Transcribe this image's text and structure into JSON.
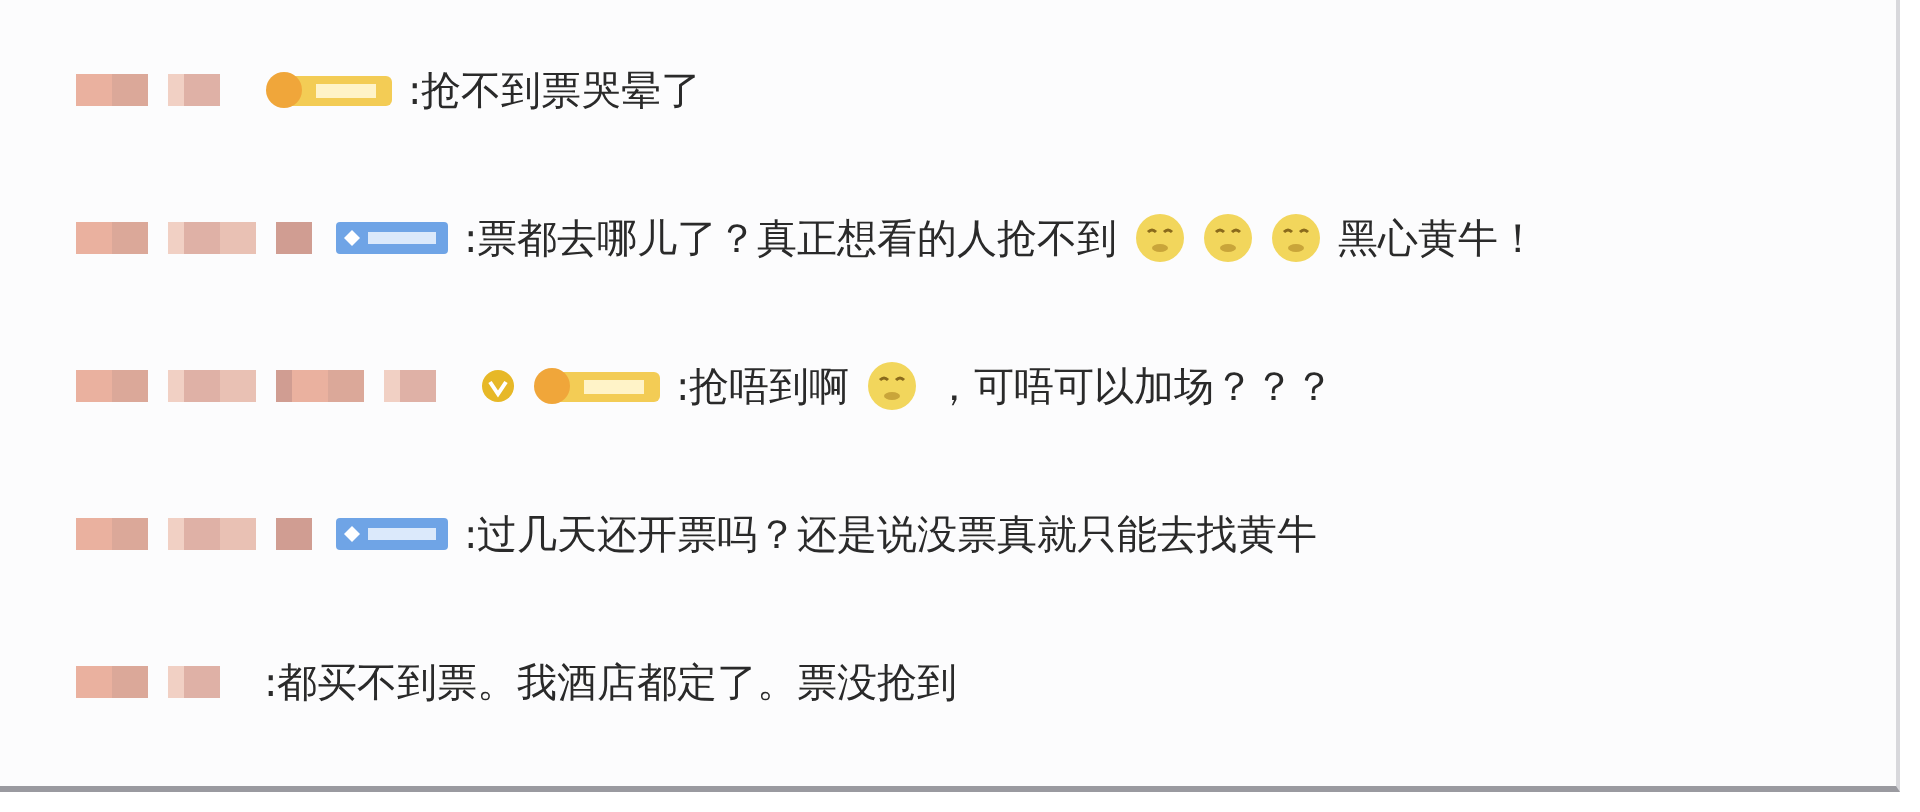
{
  "comments": [
    {
      "verified": false,
      "badge": {
        "kind": "gold"
      },
      "parts": [
        {
          "kind": "text",
          "text": ":抢不到票哭晕了"
        }
      ]
    },
    {
      "verified": false,
      "badge": {
        "kind": "blue"
      },
      "parts": [
        {
          "kind": "text",
          "text": ":票都去哪儿了？真正想看的人抢不到"
        },
        {
          "kind": "emoji"
        },
        {
          "kind": "emoji"
        },
        {
          "kind": "emoji"
        },
        {
          "kind": "text",
          "text": "黑心黄牛！"
        }
      ]
    },
    {
      "verified": true,
      "badge": {
        "kind": "gold"
      },
      "parts": [
        {
          "kind": "text",
          "text": ":抢唔到啊"
        },
        {
          "kind": "emoji"
        },
        {
          "kind": "text",
          "text": "，可唔可以加场？？？"
        }
      ]
    },
    {
      "verified": false,
      "badge": {
        "kind": "blue"
      },
      "parts": [
        {
          "kind": "text",
          "text": ":过几天还开票吗？还是说没票真就只能去找黄牛"
        }
      ]
    },
    {
      "verified": false,
      "parts": [
        {
          "kind": "text",
          "text": ":都买不到票。我酒店都定了。票没抢到"
        }
      ]
    }
  ]
}
